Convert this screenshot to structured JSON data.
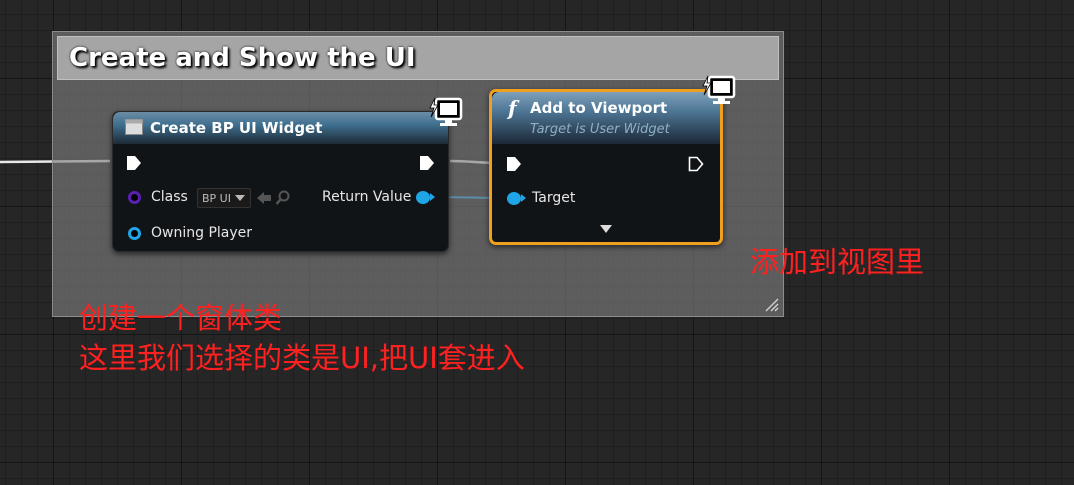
{
  "comment": {
    "title": "Create and Show the UI"
  },
  "create_node": {
    "title": "Create BP UI Widget",
    "class_label": "Class",
    "class_value": "BP UI",
    "return_label": "Return Value",
    "owning_label": "Owning Player",
    "header_color": "#3f6f8f"
  },
  "viewport_node": {
    "title": "Add to Viewport",
    "subtitle": "Target is User Widget",
    "target_label": "Target",
    "selected_color": "#f0a020",
    "function_icon": "f"
  },
  "annotations": {
    "add_to_view": "添加到视图里",
    "line1": "创建一个窗体类",
    "line2": "这里我们选择的类是UI,把UI套进入"
  },
  "colors": {
    "object_pin": "#1fa4e8",
    "class_pin": "#5a1fb3",
    "annotation": "#ff2020"
  }
}
